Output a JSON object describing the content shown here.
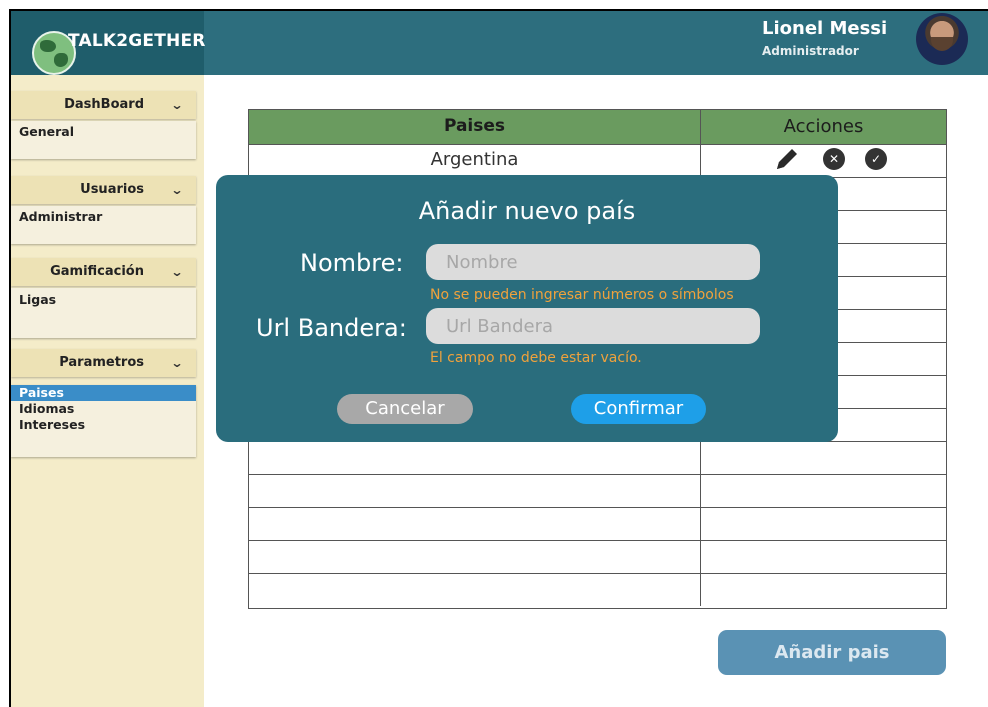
{
  "app": {
    "logo_text": "TALK2GETHER"
  },
  "user": {
    "name": "Lionel Messi",
    "role": "Administrador"
  },
  "sidebar": {
    "sections": [
      {
        "title": "DashBoard",
        "items": [
          "General"
        ]
      },
      {
        "title": "Usuarios",
        "items": [
          "Administrar"
        ]
      },
      {
        "title": "Gamificación",
        "items": [
          "Ligas"
        ]
      },
      {
        "title": "Parametros",
        "items": [
          "Paises",
          "Idiomas",
          "Intereses"
        ],
        "active_item": "Paises"
      }
    ]
  },
  "table": {
    "headers": [
      "Paises",
      "Acciones"
    ],
    "rows": [
      "Argentina",
      "",
      "",
      "",
      "",
      "",
      "",
      "",
      "",
      "",
      "",
      "",
      "",
      ""
    ]
  },
  "add_button": {
    "label": "Añadir pais"
  },
  "modal": {
    "title": "Añadir nuevo país",
    "nombre": {
      "label": "Nombre:",
      "placeholder": "Nombre",
      "value": "",
      "error": "No se pueden ingresar números o símbolos"
    },
    "url": {
      "label": "Url Bandera:",
      "placeholder": "Url Bandera",
      "value": "",
      "error": "El campo no debe estar vacío."
    },
    "cancel_label": "Cancelar",
    "confirm_label": "Confirmar"
  },
  "colors": {
    "header": "#2d6e7e",
    "sidebar": "#f4ecc9",
    "table_header": "#6a9b5f",
    "modal": "#2a6d7d",
    "error": "#f0a23c",
    "confirm": "#1e9fe8",
    "active_item": "#3a8dc8"
  },
  "icons": {
    "edit": "pencil-icon",
    "delete": "close-circle-icon",
    "approve": "check-circle-icon",
    "collapse": "chevron-down-icon"
  }
}
